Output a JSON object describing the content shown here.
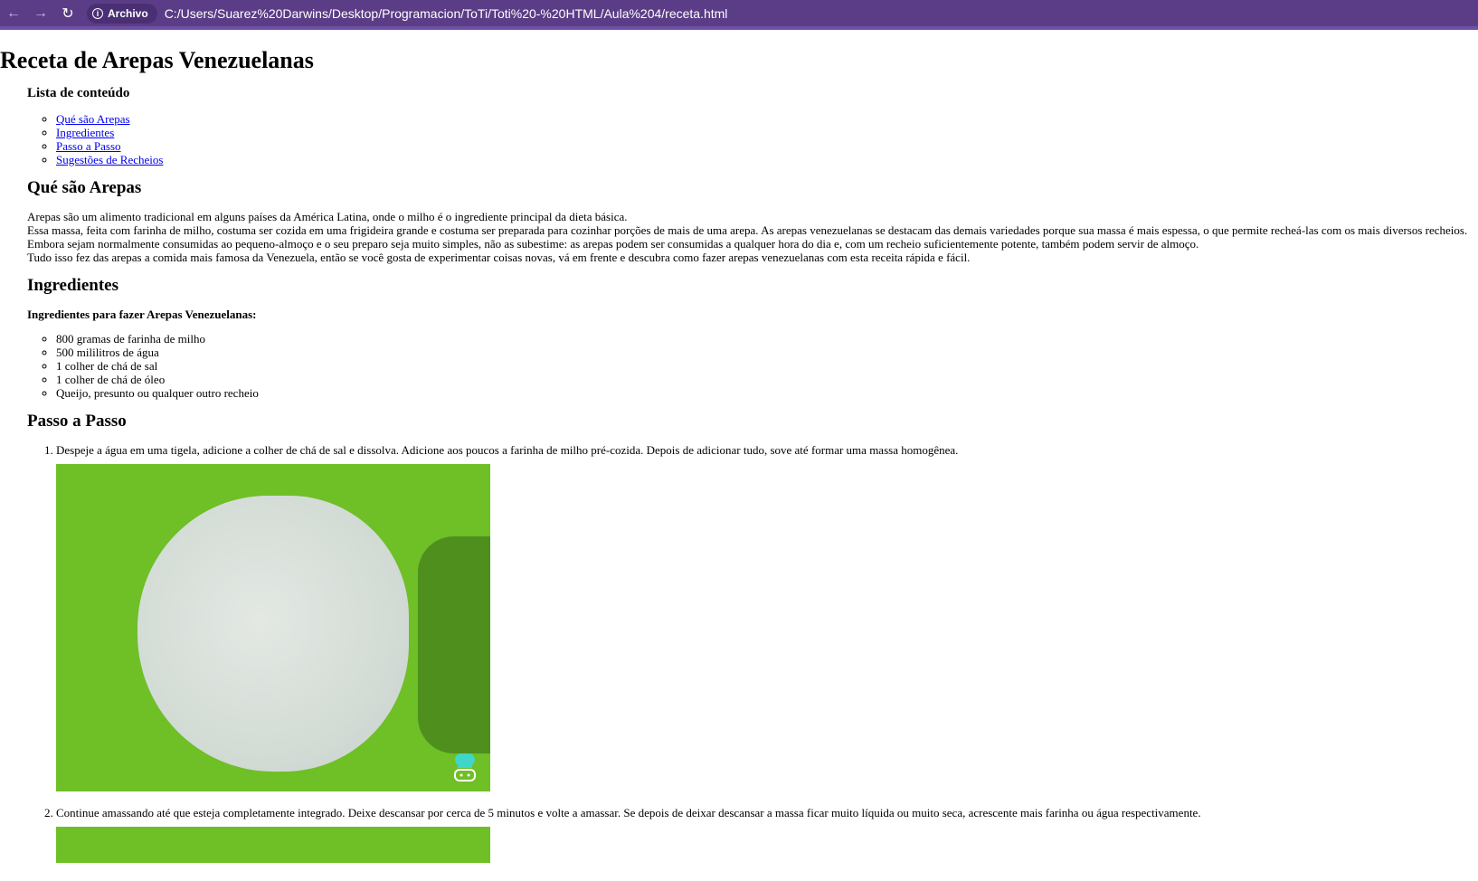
{
  "browser": {
    "back_icon": "arrow-left-icon",
    "forward_icon": "arrow-right-icon",
    "reload_icon": "reload-icon",
    "site_chip_label": "Archivo",
    "url": "C:/Users/Suarez%20Darwins/Desktop/Programacion/ToTi/Toti%20-%20HTML/Aula%204/receta.html",
    "theme_color": "#5a3d86"
  },
  "page": {
    "title": "Receta de Arepas Venezuelanas",
    "toc_title": "Lista de conteúdo",
    "toc": [
      "Qué são Arepas",
      "Ingredientes",
      "Passo a Passo",
      "Sugestões de Recheios"
    ],
    "section1_title": "Qué são Arepas",
    "section1_lines": [
      "Arepas são um alimento tradicional em alguns países da América Latina, onde o milho é o ingrediente principal da dieta básica.",
      "Essa massa, feita com farinha de milho, costuma ser cozida em uma frigideira grande e costuma ser preparada para cozinhar porções de mais de uma arepa. As arepas venezuelanas se destacam das demais variedades porque sua massa é mais espessa, o que permite recheá-las com os mais diversos recheios.",
      "Embora sejam normalmente consumidas ao pequeno-almoço e o seu preparo seja muito simples, não as subestime: as arepas podem ser consumidas a qualquer hora do dia e, com um recheio suficientemente potente, também podem servir de almoço.",
      "Tudo isso fez das arepas a comida mais famosa da Venezuela, então se você gosta de experimentar coisas novas, vá em frente e descubra como fazer arepas venezuelanas com esta receita rápida e fácil."
    ],
    "section2_title": "Ingredientes",
    "ingredients_title": "Ingredientes para fazer Arepas Venezuelanas:",
    "ingredients": [
      "800 gramas de farinha de milho",
      "500 mililitros de água",
      "1 colher de chá de sal",
      "1 colher de chá de óleo",
      "Queijo, presunto ou qualquer outro recheio"
    ],
    "section3_title": "Passo a Passo",
    "steps": [
      "Despeje a água em uma tigela, adicione a colher de chá de sal e dissolva. Adicione aos poucos a farinha de milho pré-cozida. Depois de adicionar tudo, sove até formar uma massa homogênea.",
      "Continue amassando até que esteja completamente integrado. Deixe descansar por cerca de 5 minutos e volte a amassar. Se depois de deixar descansar a massa ficar muito líquida ou muito seca, acrescente mais farinha ou água respectivamente."
    ]
  }
}
